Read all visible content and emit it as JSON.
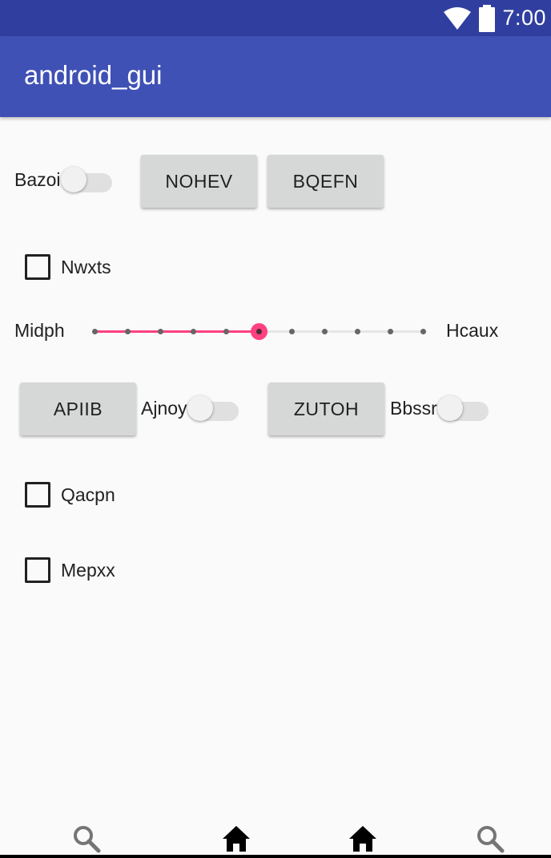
{
  "status_bar": {
    "time": "7:00",
    "icons": [
      "wifi-icon",
      "battery-icon"
    ]
  },
  "app_bar": {
    "title": "android_gui"
  },
  "row1": {
    "switch": {
      "label": "Bazoi",
      "checked": false
    },
    "buttons": [
      "NOHEV",
      "BQEFN"
    ]
  },
  "checkbox1": {
    "label": "Nwxts",
    "checked": false
  },
  "slider": {
    "min_label": "Midph",
    "max_label": "Hcaux",
    "steps": 10,
    "value": 5
  },
  "row2": {
    "button1": "APIIB",
    "switch1": {
      "label": "Ajnoy",
      "checked": false
    },
    "button2": "ZUTOH",
    "switch2": {
      "label": "Bbssr",
      "checked": false
    }
  },
  "checkbox2": {
    "label": "Qacpn",
    "checked": false
  },
  "checkbox3": {
    "label": "Mepxx",
    "checked": false
  },
  "bottom_nav": {
    "items": [
      "search-icon",
      "home-icon",
      "home-icon",
      "search-icon"
    ]
  },
  "colors": {
    "status_bar": "#303f9f",
    "app_bar": "#3f51b5",
    "accent": "#ff4081",
    "background": "#fafafa"
  }
}
